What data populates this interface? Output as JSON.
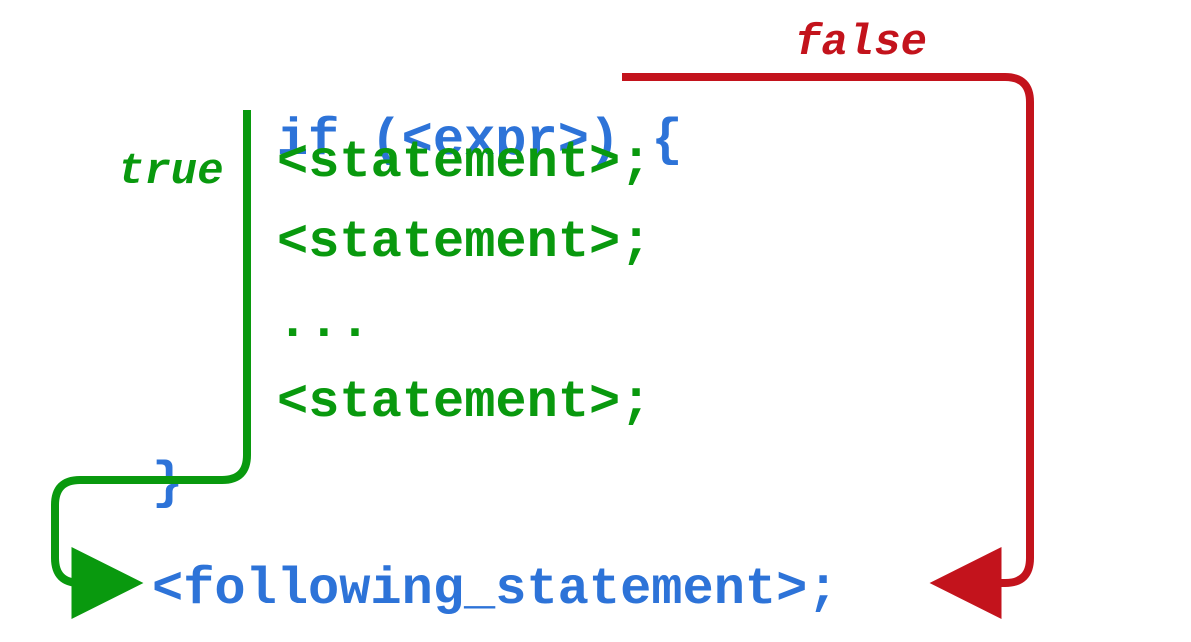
{
  "code": {
    "if_keyword": "if",
    "expr_open": " (",
    "expr_content": "<expr>",
    "expr_close": ") ",
    "brace_open": "{",
    "statement1": "<statement>;",
    "statement2": "<statement>;",
    "ellipsis": "...",
    "statement3": "<statement>;",
    "brace_close": "}",
    "following": "<following_statement>;"
  },
  "labels": {
    "true": "true",
    "false": "false"
  },
  "colors": {
    "keyword": "#2d73d8",
    "statement": "#09990e",
    "true_arrow": "#09990e",
    "false_arrow": "#c3131c"
  }
}
